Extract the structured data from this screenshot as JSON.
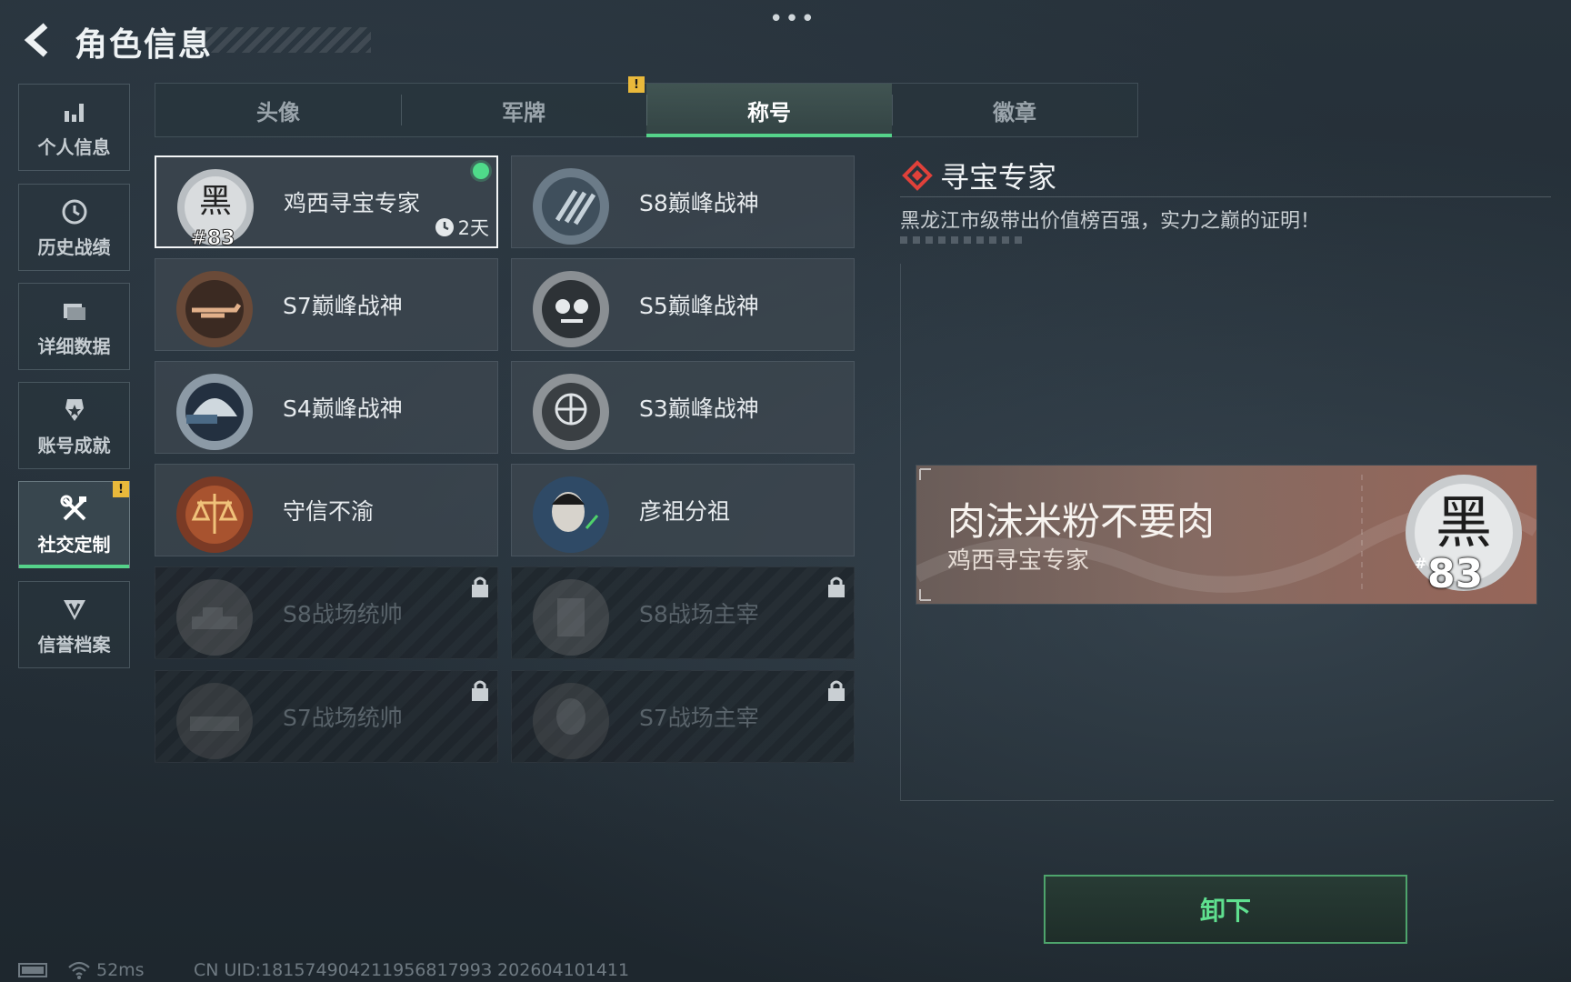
{
  "header": {
    "title": "角色信息",
    "more_label": "•••"
  },
  "sidebar": {
    "items": [
      {
        "label": "个人信息",
        "icon": "bar-chart-icon"
      },
      {
        "label": "历史战绩",
        "icon": "history-clock-icon"
      },
      {
        "label": "详细数据",
        "icon": "folder-icon"
      },
      {
        "label": "账号成就",
        "icon": "achievement-icon"
      },
      {
        "label": "社交定制",
        "icon": "tools-icon",
        "active": true,
        "alert": "!"
      },
      {
        "label": "信誉档案",
        "icon": "shield-icon"
      }
    ]
  },
  "tabs": {
    "items": [
      {
        "label": "头像"
      },
      {
        "label": "军牌"
      },
      {
        "label": "称号",
        "active": true
      },
      {
        "label": "徽章"
      }
    ],
    "alert": "!"
  },
  "titles": {
    "items": [
      {
        "name": "鸡西寻宝专家",
        "emblem": "black-83-emblem",
        "selected": true,
        "equipped": true,
        "timer": "2天"
      },
      {
        "name": "S8巅峰战神",
        "emblem": "s8-peak-emblem"
      },
      {
        "name": "S7巅峰战神",
        "emblem": "s7-peak-emblem"
      },
      {
        "name": "S5巅峰战神",
        "emblem": "s5-peak-emblem"
      },
      {
        "name": "S4巅峰战神",
        "emblem": "s4-peak-emblem"
      },
      {
        "name": "S3巅峰战神",
        "emblem": "s3-peak-emblem"
      },
      {
        "name": "守信不渝",
        "emblem": "scales-emblem"
      },
      {
        "name": "彦祖分祖",
        "emblem": "portrait-emblem"
      },
      {
        "name": "S8战场统帅",
        "emblem": "tank-emblem",
        "locked": true
      },
      {
        "name": "S8战场主宰",
        "emblem": "building-emblem",
        "locked": true
      },
      {
        "name": "S7战场统帅",
        "emblem": "vehicle-emblem",
        "locked": true
      },
      {
        "name": "S7战场主宰",
        "emblem": "soldier-emblem",
        "locked": true
      }
    ]
  },
  "detail": {
    "title": "寻宝专家",
    "description": "黑龙江市级带出价值榜百强，实力之巅的证明！",
    "banner": {
      "player_name": "肉沫米粉不要肉",
      "title": "鸡西寻宝专家",
      "emblem_char": "黑",
      "rank_prefix": "#",
      "rank": "83"
    },
    "unequip_label": "卸下"
  },
  "status_bar": {
    "ping": "52ms",
    "uid": "CN UID:18157490421195681799З 202604101411"
  },
  "colors": {
    "accent_green": "#55d38a",
    "alert_yellow": "#e9b93b",
    "diamond_red": "#e0413a"
  }
}
